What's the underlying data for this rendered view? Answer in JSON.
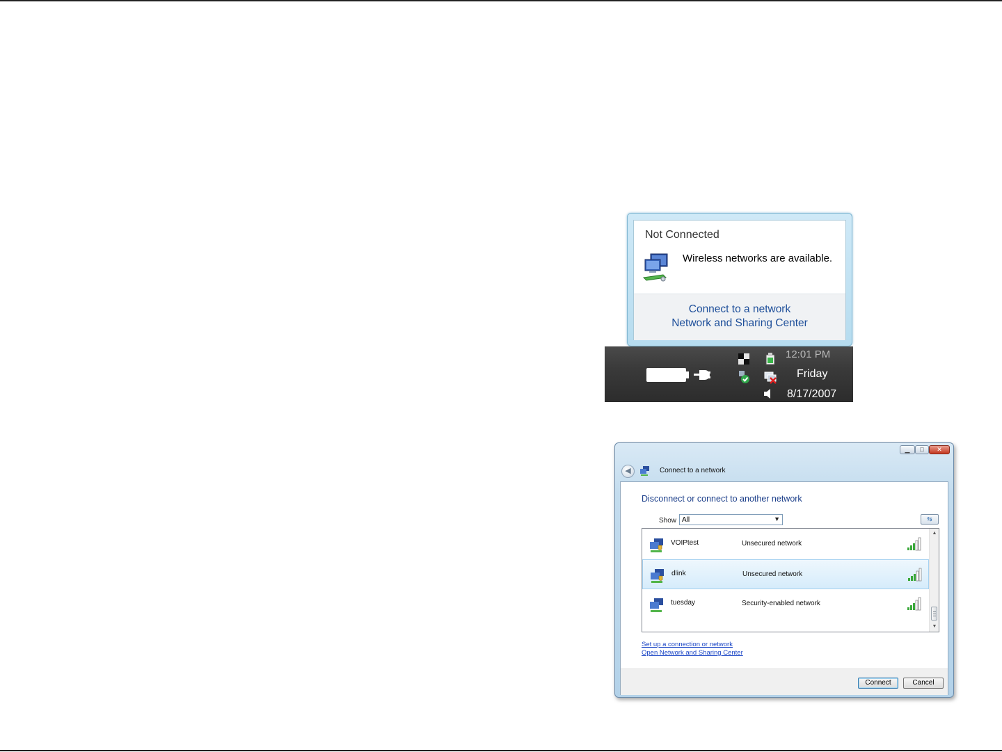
{
  "popup": {
    "title": "Not Connected",
    "message": "Wireless networks are available.",
    "links": [
      "Connect to a network",
      "Network and Sharing Center"
    ]
  },
  "taskbar": {
    "time": "12:01 PM",
    "day": "Friday",
    "date": "8/17/2007"
  },
  "window": {
    "title": "Connect to a network",
    "heading": "Disconnect or connect to another network",
    "show_label": "Show",
    "show_value": "All",
    "networks": [
      {
        "name": "VOIPtest",
        "status": "Unsecured network",
        "signal_bars": 5,
        "selected": false
      },
      {
        "name": "dlink",
        "status": "Unsecured network",
        "signal_bars": 5,
        "selected": true
      },
      {
        "name": "tuesday",
        "status": "Security-enabled network",
        "signal_bars": 5,
        "selected": false
      }
    ],
    "links": [
      "Set up a connection or network",
      "Open Network and Sharing Center"
    ],
    "buttons": {
      "connect": "Connect",
      "cancel": "Cancel"
    }
  },
  "colors": {
    "link": "#1e4f9a",
    "heading": "#1c3f8a",
    "signal": "#3aa83a"
  }
}
